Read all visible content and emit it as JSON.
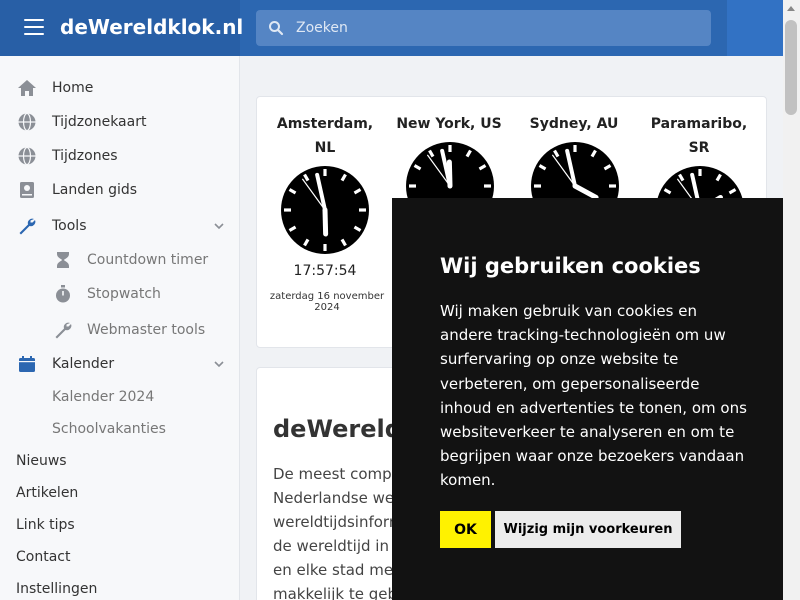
{
  "header": {
    "logo": "deWereldklok.nl",
    "search_placeholder": "Zoeken"
  },
  "sidebar": {
    "items": [
      {
        "label": "Home",
        "icon": "home-icon"
      },
      {
        "label": "Tijdzonekaart",
        "icon": "globe-icon"
      },
      {
        "label": "Tijdzones",
        "icon": "globe-icon"
      },
      {
        "label": "Landen gids",
        "icon": "book-icon"
      },
      {
        "label": "Tools",
        "icon": "wrench-icon"
      },
      {
        "label": "Countdown timer",
        "icon": "hourglass-icon"
      },
      {
        "label": "Stopwatch",
        "icon": "stopwatch-icon"
      },
      {
        "label": "Webmaster tools",
        "icon": "wrench-icon"
      },
      {
        "label": "Kalender",
        "icon": "calendar-icon"
      },
      {
        "label": "Kalender 2024"
      },
      {
        "label": "Schoolvakanties"
      },
      {
        "label": "Nieuws"
      },
      {
        "label": "Artikelen"
      },
      {
        "label": "Link tips"
      },
      {
        "label": "Contact"
      },
      {
        "label": "Instellingen"
      }
    ]
  },
  "clocks": [
    {
      "city_line1": "Amsterdam,",
      "city_line2": "NL",
      "time": "17:57:54",
      "date": "zaterdag 16 november 2024",
      "hour": 17,
      "minute": 57,
      "second": 54
    },
    {
      "city_line1": "New York, US",
      "city_line2": "",
      "hour": 11,
      "minute": 57,
      "second": 54
    },
    {
      "city_line1": "Sydney, AU",
      "city_line2": "",
      "hour": 3,
      "minute": 57,
      "second": 54
    },
    {
      "city_line1": "Paramaribo,",
      "city_line2": "SR",
      "hour": 13,
      "minute": 57,
      "second": 54
    }
  ],
  "content": {
    "title": "deWereldk",
    "lines": [
      "De meest comple",
      "Nederlandse web",
      "wereldtijdsinform",
      "de wereldtijd in",
      "en elke stad met",
      "makkelijk te geb"
    ]
  },
  "cookie": {
    "title": "Wij gebruiken cookies",
    "body": "Wij maken gebruik van cookies en andere tracking-technologieën om uw surfervaring op onze website te verbeteren, om gepersonaliseerde inhoud en advertenties te tonen, om ons websiteverkeer te analyseren en om te begrijpen waar onze bezoekers vandaan komen.",
    "ok_label": "OK",
    "pref_label": "Wijzig mijn voorkeuren"
  },
  "colors": {
    "header": "#2c67b1",
    "sidebar_icon": "#8b8f96",
    "active_icon": "#2c67b1",
    "cookie_bg": "#121212",
    "ok_button": "#fff200"
  }
}
